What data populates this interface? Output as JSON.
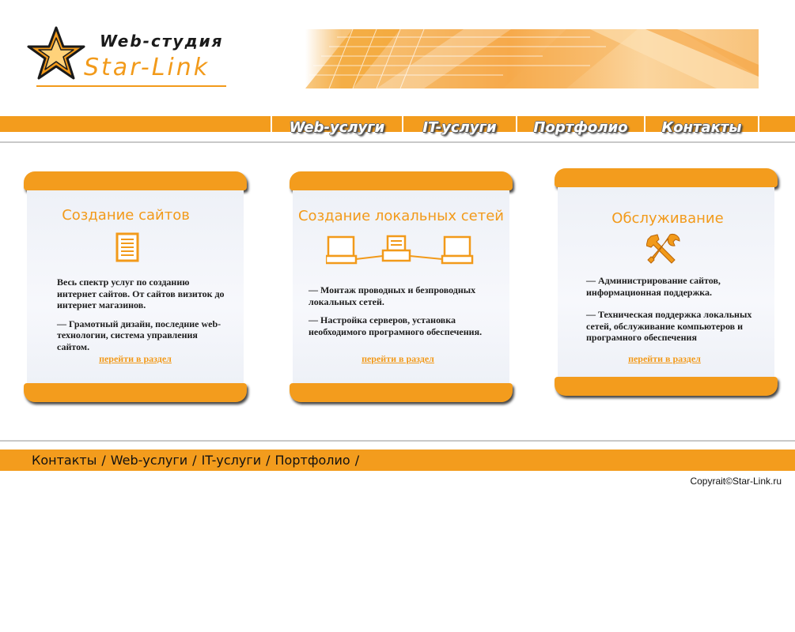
{
  "logo": {
    "studio": "Web-студия",
    "name": "Star-Link"
  },
  "colors": {
    "accent": "#f39c1d",
    "divider": "#c9c9c9",
    "card_bg": "#f3f5fa"
  },
  "nav": {
    "items": [
      {
        "label": "Web-услуги"
      },
      {
        "label": "IT-услуги"
      },
      {
        "label": "Портфолио"
      },
      {
        "label": "Контакты"
      }
    ]
  },
  "cards": [
    {
      "title": "Создание сайтов",
      "icon": "document-icon",
      "paragraphs": [
        "Весь спектр услуг по созданию интернет сайтов. От сайтов визиток до интернет магазинов.",
        "— Грамотный дизайн, последние web-технологии, система управления сайтом."
      ],
      "link": "перейти в раздел"
    },
    {
      "title": "Создание локальных сетей",
      "icon": "network-icon",
      "paragraphs": [
        "— Монтаж проводных и безпроводных локальных сетей.",
        "— Настройка серверов, установка необходимого програмного обеспечения."
      ],
      "link": "перейти в раздел"
    },
    {
      "title": "Обслуживание",
      "icon": "tools-icon",
      "paragraphs": [
        "— Администрирование сайтов, информационная поддержка.",
        "— Техническая поддержка локальных сетей, обслуживание компьютеров и програмного обеспечения"
      ],
      "link": "перейти в раздел"
    }
  ],
  "footer": {
    "links": [
      {
        "label": "Контакты"
      },
      {
        "label": "Web-услуги"
      },
      {
        "label": "IT-услуги"
      },
      {
        "label": "Портфолио"
      }
    ],
    "separator": "/",
    "copyright": "Copyrait©Star-Link.ru"
  }
}
